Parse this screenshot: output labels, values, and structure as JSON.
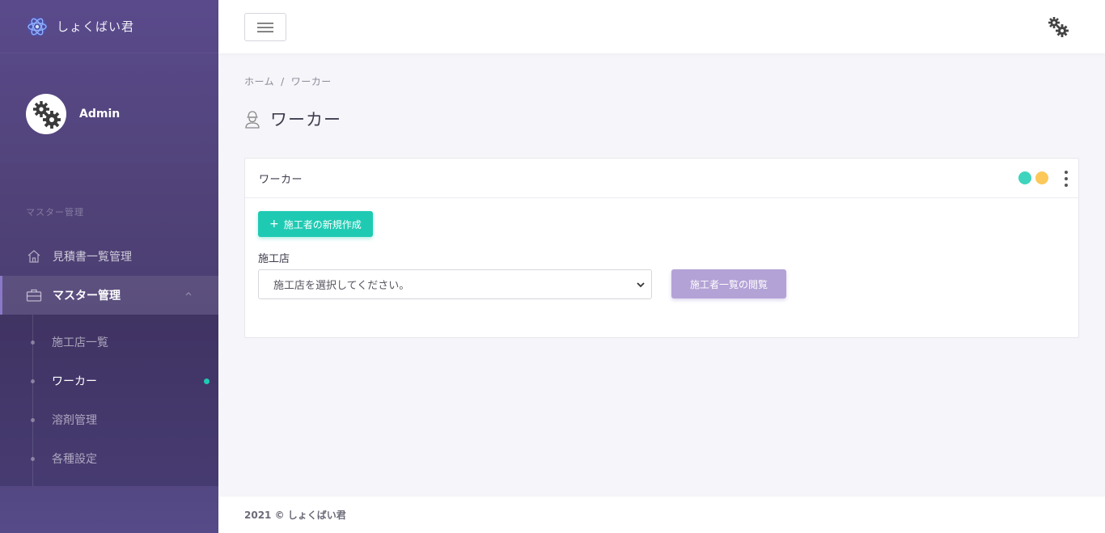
{
  "app": {
    "brand_name": "しょくばい君"
  },
  "sidebar": {
    "profile_name": "Admin",
    "section_title": "マスター管理",
    "items": [
      {
        "label": "見積書一覧管理",
        "icon": "home-icon"
      },
      {
        "label": "マスター管理",
        "icon": "toolbox-icon",
        "active": true,
        "expanded": true
      }
    ],
    "subitems": [
      {
        "label": "施工店一覧"
      },
      {
        "label": "ワーカー",
        "active": true
      },
      {
        "label": "溶剤管理"
      },
      {
        "label": "各種設定"
      }
    ]
  },
  "topbar": {
    "menu_icon": "hamburger-icon",
    "settings_icon": "gears-icon"
  },
  "breadcrumb": {
    "home": "ホーム",
    "separator": "/",
    "current": "ワーカー"
  },
  "page": {
    "title": "ワーカー",
    "icon": "worker-icon"
  },
  "card": {
    "title": "ワーカー",
    "create_button": "施工者の新規作成",
    "field_label": "施工店",
    "select_placeholder": "施工店を選択してください。",
    "view_button": "施工者一覧の閲覧"
  },
  "footer": {
    "text": "2021 © しょくばい君"
  },
  "colors": {
    "accent_teal": "#1fcab3",
    "accent_purple": "#b3a2d6",
    "indicator_yellow": "#fcc85a",
    "sidebar": "#514379"
  }
}
